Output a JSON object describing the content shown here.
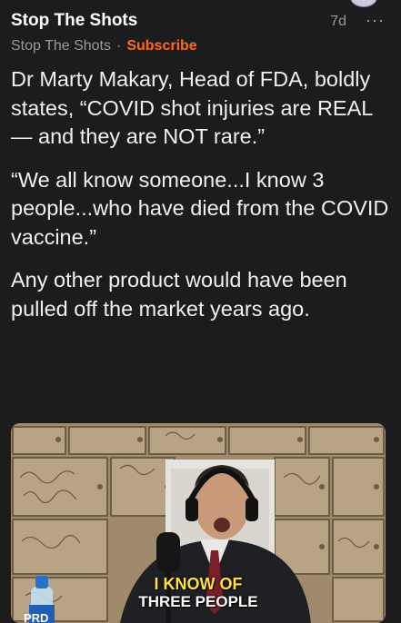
{
  "post": {
    "author": "Stop The Shots",
    "time": "7d",
    "more_icon": "···",
    "publication": "Stop The Shots",
    "separator": "·",
    "subscribe_label": "Subscribe",
    "paragraphs": [
      "Dr Marty Makary, Head of FDA, boldly states, “COVID shot injuries are REAL — and they are NOT rare.”",
      "“We all know someone...I know 3 people...who have died from the COVID vaccine.”",
      "Any other product would have been pulled off the market years ago."
    ]
  },
  "video": {
    "caption_line1": "I KNOW OF",
    "caption_line2": "THREE PEOPLE",
    "bottle_text": "PRD"
  },
  "icons": {
    "more": "more-icon",
    "avatar": "avatar"
  }
}
